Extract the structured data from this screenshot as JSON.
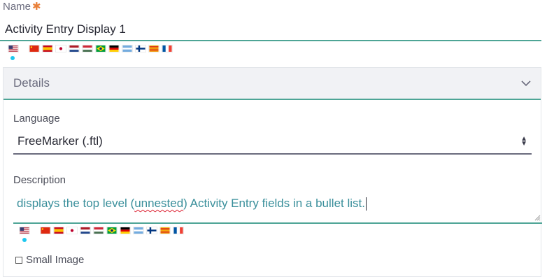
{
  "name_field": {
    "label": "Name",
    "required_mark": "✱",
    "value": "Activity Entry Display 1"
  },
  "locale_flags": [
    {
      "code": "en-US",
      "icon": "flag-us-icon",
      "colors": [
        "#3c3b6e",
        "#b22234",
        "#ffffff"
      ]
    },
    {
      "code": "zh-CN",
      "icon": "flag-cn-icon",
      "colors": [
        "#de2910",
        "#ffde00"
      ]
    },
    {
      "code": "es-ES",
      "icon": "flag-es-icon",
      "colors": [
        "#c60b1e",
        "#ffc400"
      ]
    },
    {
      "code": "ja-JP",
      "icon": "flag-jp-icon",
      "colors": [
        "#ffffff",
        "#bc002d"
      ]
    },
    {
      "code": "nl-NL",
      "icon": "flag-nl-icon",
      "colors": [
        "#ae1c28",
        "#ffffff",
        "#21468b"
      ]
    },
    {
      "code": "hu-HU",
      "icon": "flag-hu-icon",
      "colors": [
        "#ce2939",
        "#ffffff",
        "#477050"
      ]
    },
    {
      "code": "pt-BR",
      "icon": "flag-br-icon",
      "colors": [
        "#009c3b",
        "#ffdf00",
        "#002776"
      ]
    },
    {
      "code": "de-DE",
      "icon": "flag-de-icon",
      "colors": [
        "#000000",
        "#dd0000",
        "#ffce00"
      ]
    },
    {
      "code": "ar-SA",
      "icon": "flag-ar-icon",
      "colors": [
        "#74acdf",
        "#ffffff"
      ]
    },
    {
      "code": "fi-FI",
      "icon": "flag-fi-icon",
      "colors": [
        "#ffffff",
        "#003580"
      ]
    },
    {
      "code": "ca-ES",
      "icon": "flag-ca-icon",
      "colors": [
        "#fcdd09",
        "#da121a"
      ]
    },
    {
      "code": "fr-FR",
      "icon": "flag-fr-icon",
      "colors": [
        "#0055a4",
        "#ffffff",
        "#ef4135"
      ]
    }
  ],
  "details_panel": {
    "title": "Details",
    "language": {
      "label": "Language",
      "selected": "FreeMarker (.ftl)"
    },
    "description": {
      "label": "Description",
      "text_before": "displays the top level (",
      "misspelled": "unnested",
      "text_after": ") Activity Entry fields in a bullet list."
    },
    "small_image": {
      "label": "Small Image",
      "checked": false
    }
  },
  "colors": {
    "accent": "#4ea596",
    "active_dot": "#1ec8ef",
    "required": "#e8803a"
  }
}
